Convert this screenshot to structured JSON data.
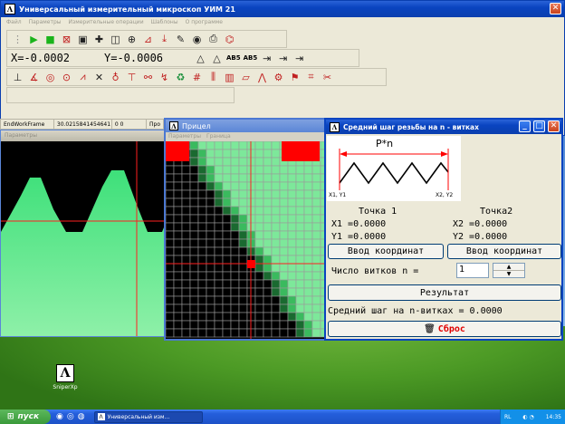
{
  "main_window": {
    "title": "Универсальный измерительный микроскоп УИМ 21",
    "menu": [
      "Файл",
      "Параметры",
      "Измерительные операции",
      "Шаблоны",
      "О программе"
    ],
    "x_readout": "X=-0.0002",
    "y_readout": "Y=-0.0006",
    "mode_labels": [
      "AB5",
      "AB5"
    ],
    "status": [
      "EndWorkFrame",
      "30.0215841454641",
      "0 0",
      "Про"
    ],
    "panel_menu": "Параметры"
  },
  "sight_window": {
    "title": "Прицел",
    "menu": [
      "Параметры",
      "Граница"
    ]
  },
  "thread_window": {
    "title": "Средний шаг резьбы на n - витках",
    "diagram_label": "P*n",
    "diagram_p1": "X1, Y1",
    "diagram_p2": "X2, Y2",
    "point1_title": "Точка 1",
    "point2_title": "Точка2",
    "x1": "X1 =0.0000",
    "y1": "Y1 =0.0000",
    "x2": "X2 =0.0000",
    "y2": "Y2 =0.0000",
    "enter_btn1": "Ввод координат",
    "enter_btn2": "Ввод координат",
    "turns_label": "Число витков n =",
    "turns_value": "1",
    "result_btn": "Результат",
    "result_text": "Средний шаг на n-витках = 0.0000",
    "reset_btn": "Сброс"
  },
  "desktop": {
    "icon_label": "SniperXp"
  },
  "taskbar": {
    "start": "пуск",
    "task": "Универсальный изм...",
    "lang": "RL",
    "time": "14:35"
  },
  "colors": {
    "title_blue": "#0a44c0",
    "profile_green": "#5ce38a",
    "red": "#ff0000"
  }
}
